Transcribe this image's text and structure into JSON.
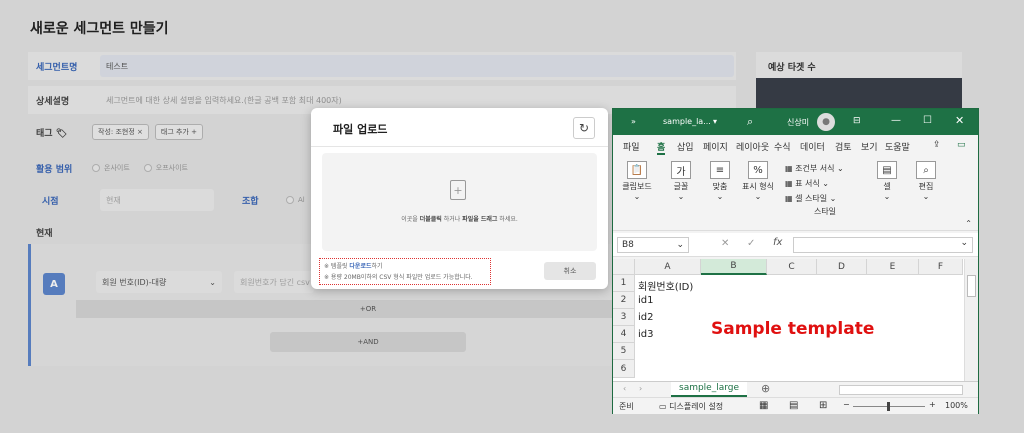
{
  "page": {
    "title": "새로운 세그먼트 만들기",
    "segment_name_label": "세그먼트명",
    "segment_name_value": "테스트",
    "desc_label": "상세설명",
    "desc_placeholder": "세그먼트에 대한 상세 설명을 입력하세요.(한글 공백 포함 최대 400자)",
    "tag_label": "태그",
    "tag_chip": "작성: 조현정 ×",
    "tag_add": "태그 추가 +",
    "scope_label": "활용 범위",
    "scope_online": "온사이트",
    "scope_offline": "오프사이트",
    "time_label": "시점",
    "time_value": "현재",
    "combo_label": "조합",
    "combo_value": "Al",
    "now_label": "현재",
    "a_badge": "A",
    "member_select": "회원 번호(ID)-대량",
    "member_placeholder": "회원번호가 담긴 csv",
    "or_label": "+OR",
    "and_label": "+AND",
    "side_title": "예상 타겟 수"
  },
  "modal": {
    "title": "파일 업로드",
    "drop_text_pre": "이곳을 ",
    "drop_text_b1": "더블클릭",
    "drop_text_mid": " 하거나 ",
    "drop_text_b2": "파일을 드래그",
    "drop_text_post": " 하세요.",
    "note1_pre": "※ 템플릿 ",
    "note1_link": "다운로드",
    "note1_post": "하기",
    "note2": "※ 용량 20MB이하의 CSV 형식 파일만 업로드 가능합니다.",
    "cancel_label": "취소"
  },
  "excel": {
    "filename": "sample_la...",
    "user": "신상미",
    "tabs": [
      "파일",
      "홈",
      "삽입",
      "페이지",
      "레이아웃",
      "수식",
      "데이터",
      "검토",
      "보기",
      "도움말"
    ],
    "groups": {
      "clipboard": "클립보드",
      "font": "글꼴",
      "align": "맞춤",
      "number": "표시 형식",
      "cond": "조건부 서식",
      "table": "표 서식",
      "cellstyle": "셀 스타일",
      "style": "스타일",
      "cells": "셀",
      "edit": "편집"
    },
    "namebox": "B8",
    "columns": [
      "A",
      "B",
      "C",
      "D",
      "E",
      "F"
    ],
    "rows": [
      "1",
      "2",
      "3",
      "4",
      "5",
      "6"
    ],
    "cells": [
      "회원번호(ID)",
      "id1",
      "id2",
      "id3"
    ],
    "sheet_tab": "sample_large",
    "status_ready": "준비",
    "status_display": "디스플레이 설정",
    "zoom": "100%"
  },
  "annotation": "Sample template"
}
